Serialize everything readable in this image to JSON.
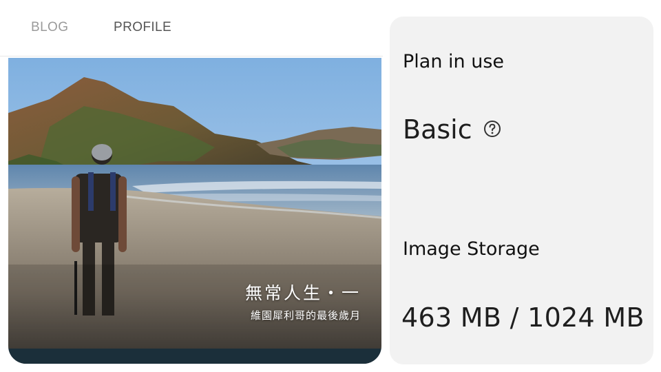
{
  "tabs": [
    {
      "label": "BLOG",
      "active": false
    },
    {
      "label": "PROFILE",
      "active": true
    }
  ],
  "cover": {
    "title": "無常人生・一",
    "subtitle": "維園犀利哥的最後歲月"
  },
  "plan": {
    "label": "Plan in use",
    "value": "Basic",
    "help_icon": "question-circle-icon"
  },
  "storage": {
    "label": "Image Storage",
    "value": "463 MB / 1024 MB"
  }
}
